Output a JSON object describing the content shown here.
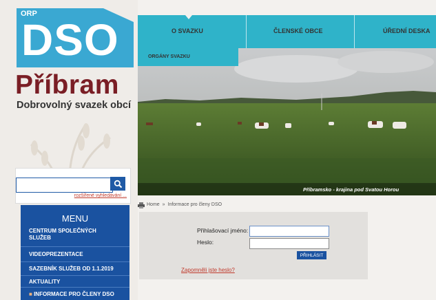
{
  "logo": {
    "orp": "ORP",
    "dso": "DSO",
    "city": "Příbram",
    "subtitle": "Dobrovolný svazek obcí"
  },
  "search": {
    "placeholder": "",
    "advanced_link": "rozšířené vyhledávání ..."
  },
  "nav": {
    "items": [
      "O SVAZKU",
      "ČLENSKÉ OBCE",
      "ÚŘEDNÍ DESKA"
    ],
    "sub_item": "ORGÁNY SVAZKU"
  },
  "photo": {
    "caption": "Příbramsko - krajina pod Svatou Horou"
  },
  "breadcrumb": {
    "home": "Home",
    "separator": "»",
    "current": "Informace pro členy DSO"
  },
  "menu": {
    "title": "MENU",
    "items": [
      "CENTRUM SPOLEČNÝCH",
      "SLUŽEB",
      "VIDEOPREZENTACE",
      "SAZEBNÍK SLUŽEB OD 1.1.2019",
      "AKTUALITY",
      "INFORMACE PRO ČLENY DSO"
    ]
  },
  "login": {
    "username_label": "Přihlašovací jméno:",
    "password_label": "Heslo:",
    "username_value": "",
    "password_value": "",
    "submit_label": "PŘIHLÁSIT",
    "forgot_link": "Zapomněli jste heslo?"
  },
  "colors": {
    "accent": "#2fb3c9",
    "menu": "#1a52a0",
    "brand": "#7a1e25",
    "logo": "#3aa8d2"
  }
}
